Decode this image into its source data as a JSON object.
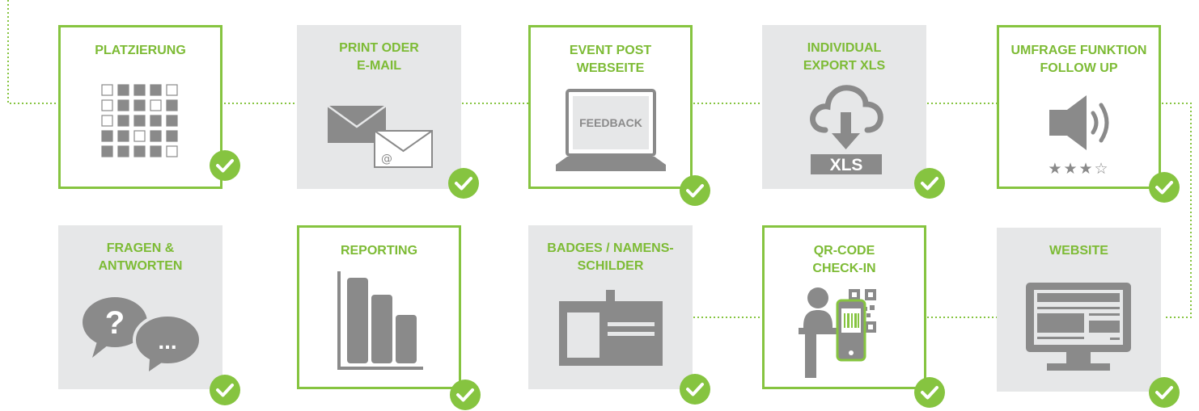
{
  "colors": {
    "accent": "#86c440",
    "accent_text": "#7dbb35",
    "card_fill": "#e6e7e8",
    "icon_gray": "#8a8a8a",
    "dotted_line": "#86c440"
  },
  "cards": [
    {
      "id": "platzierung",
      "title": "PLATZIERUNG",
      "style": "outline",
      "icon": "seating-grid-icon"
    },
    {
      "id": "print-email",
      "title": "PRINT ODER\nE-MAIL",
      "style": "filled",
      "icon": "envelope-icon"
    },
    {
      "id": "event-post",
      "title": "EVENT POST\nWEBSEITE",
      "style": "outline",
      "icon": "laptop-feedback-icon",
      "icon_text": "FEEDBACK"
    },
    {
      "id": "export-xls",
      "title": "INDIVIDUAL\nEXPORT XLS",
      "style": "filled",
      "icon": "cloud-download-icon",
      "icon_text": "XLS"
    },
    {
      "id": "umfrage",
      "title": "UMFRAGE FUNKTION\nFOLLOW UP",
      "style": "outline",
      "icon": "speaker-icon",
      "rating": 3,
      "rating_max": 4
    },
    {
      "id": "fragen",
      "title": "FRAGEN &\nANTWORTEN",
      "style": "filled",
      "icon": "speech-bubbles-icon",
      "icon_text": "?",
      "icon_text_2": "..."
    },
    {
      "id": "reporting",
      "title": "REPORTING",
      "style": "outline",
      "icon": "bar-chart-icon"
    },
    {
      "id": "badges",
      "title": "BADGES / NAMENS-\nSCHILDER",
      "style": "filled",
      "icon": "badge-icon"
    },
    {
      "id": "qr-checkin",
      "title": "QR-CODE\nCHECK-IN",
      "style": "outline",
      "icon": "qr-checkin-icon"
    },
    {
      "id": "website",
      "title": "WEBSITE",
      "style": "filled",
      "icon": "monitor-website-icon"
    }
  ]
}
